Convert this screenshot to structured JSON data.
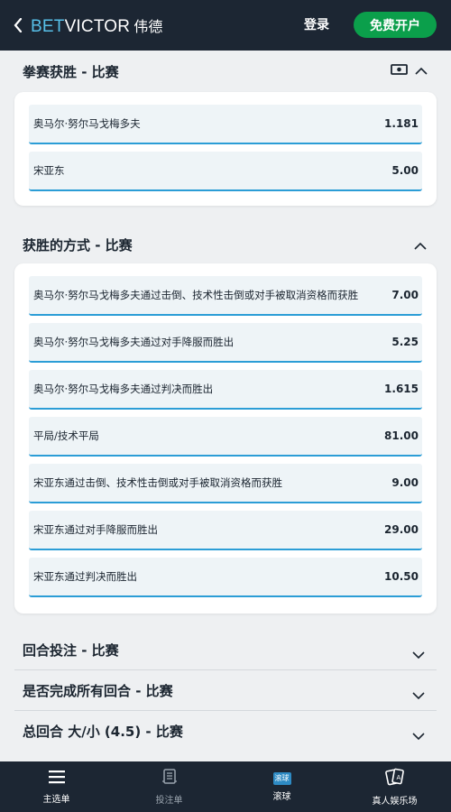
{
  "header": {
    "logo_bet": "BET",
    "logo_victor": "VICTOR",
    "logo_cn": "伟德",
    "login_label": "登录",
    "register_label": "免费开户"
  },
  "sections": {
    "fight_winner": {
      "title": "拳赛获胜 - 比赛",
      "selections": [
        {
          "name": "奥马尔·努尔马戈梅多夫",
          "odds": "1.181"
        },
        {
          "name": "宋亚东",
          "odds": "5.00"
        }
      ]
    },
    "method_of_victory": {
      "title": "获胜的方式 - 比赛",
      "selections": [
        {
          "name": "奥马尔·努尔马戈梅多夫通过击倒、技术性击倒或对手被取消资格而获胜",
          "odds": "7.00"
        },
        {
          "name": "奥马尔·努尔马戈梅多夫通过对手降服而胜出",
          "odds": "5.25"
        },
        {
          "name": "奥马尔·努尔马戈梅多夫通过判决而胜出",
          "odds": "1.615"
        },
        {
          "name": "平局/技术平局",
          "odds": "81.00"
        },
        {
          "name": "宋亚东通过击倒、技术性击倒或对手被取消资格而获胜",
          "odds": "9.00"
        },
        {
          "name": "宋亚东通过对手降服而胜出",
          "odds": "29.00"
        },
        {
          "name": "宋亚东通过判决而胜出",
          "odds": "10.50"
        }
      ]
    },
    "collapsed": [
      {
        "title": "回合投注 - 比赛"
      },
      {
        "title": "是否完成所有回合 - 比赛"
      },
      {
        "title": "总回合 大/小 (4.5) - 比赛"
      }
    ]
  },
  "bottom_nav": [
    {
      "label": "主选单",
      "icon": "menu-icon"
    },
    {
      "label": "投注单",
      "icon": "betslip-icon"
    },
    {
      "label": "滚球",
      "icon": "live-icon",
      "badge": "滚球"
    },
    {
      "label": "真人娱乐场",
      "icon": "cards-icon"
    }
  ],
  "colors": {
    "header_bg": "#1c2633",
    "accent_blue": "#2b9dd6",
    "register_green": "#0b9f4b",
    "page_bg": "#eef0f2"
  }
}
